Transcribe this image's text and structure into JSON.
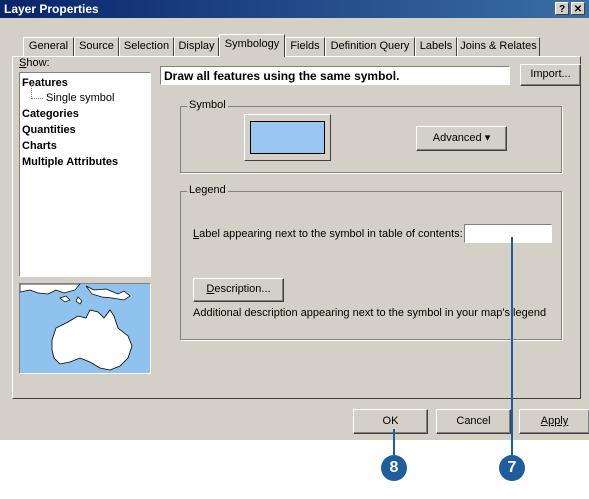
{
  "window": {
    "title": "Layer Properties",
    "help_label": "?",
    "close_label": "✕"
  },
  "tabs": [
    {
      "label": "General"
    },
    {
      "label": "Source"
    },
    {
      "label": "Selection"
    },
    {
      "label": "Display"
    },
    {
      "label": "Symbology"
    },
    {
      "label": "Fields"
    },
    {
      "label": "Definition Query"
    },
    {
      "label": "Labels"
    },
    {
      "label": "Joins & Relates"
    }
  ],
  "active_tab": "Symbology",
  "show_panel": {
    "label_first": "S",
    "label_rest": "how:",
    "items": [
      {
        "label": "Features"
      },
      {
        "label": "Single symbol"
      },
      {
        "label": "Categories"
      },
      {
        "label": "Quantities"
      },
      {
        "label": "Charts"
      },
      {
        "label": "Multiple Attributes"
      }
    ]
  },
  "main": {
    "header_text": "Draw all features using the same symbol.",
    "import_label": "Import...",
    "symbol_group_title": "Symbol",
    "advanced_label": "Advanced",
    "advanced_arrow": "▾",
    "legend_group_title": "Legend",
    "label_caption_first": "L",
    "label_caption_rest": "abel appearing next to the symbol in table of contents:",
    "label_value": "",
    "description_first": "D",
    "description_rest": "escription...",
    "description_help": "Additional description appearing next to the symbol in your map's legend",
    "symbol_color": "#99c6f0"
  },
  "footer": {
    "ok_label": "OK",
    "cancel_label": "Cancel",
    "apply_label": "Apply"
  },
  "callouts": [
    {
      "number": "8"
    },
    {
      "number": "7"
    }
  ]
}
